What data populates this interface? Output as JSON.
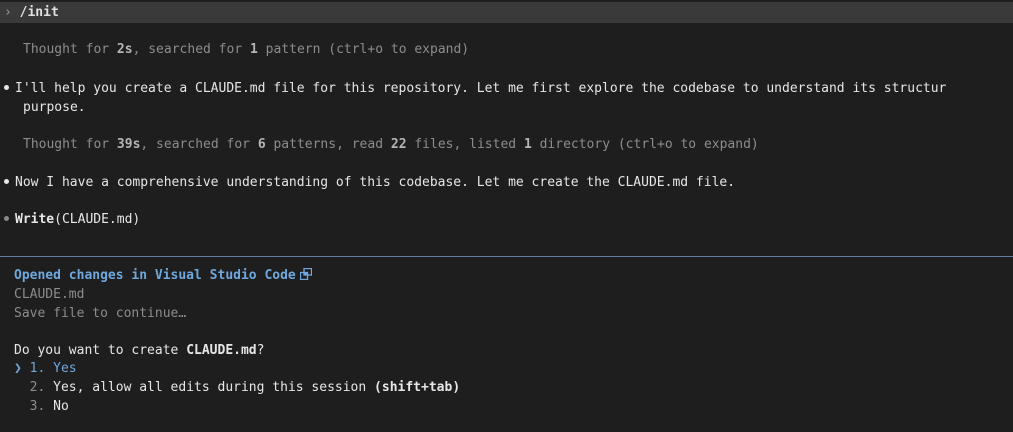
{
  "command": {
    "prompt_glyph": "›",
    "text": "/init"
  },
  "thought1": {
    "prefix": "Thought for ",
    "time": "2s",
    "mid1": ", searched for ",
    "patterns": "1",
    "mid2": " pattern (ctrl+o to expand)"
  },
  "message1": {
    "line1": "I'll help you create a CLAUDE.md file for this repository. Let me first explore the codebase to understand its structur",
    "line2": "purpose."
  },
  "thought2": {
    "prefix": "Thought for ",
    "time": "39s",
    "a": ", searched for ",
    "patterns": "6",
    "b": " patterns, read ",
    "files": "22",
    "c": " files, listed ",
    "dirs": "1",
    "d": " directory (ctrl+o to expand)"
  },
  "message2": "Now I have a comprehensive understanding of this codebase. Let me create the CLAUDE.md file.",
  "tool_call": {
    "name": "Write",
    "arg": "(CLAUDE.md)"
  },
  "panel": {
    "title": "Opened changes in Visual Studio Code",
    "icon": "external-window-icon",
    "filename": "CLAUDE.md",
    "hint": "Save file to continue…",
    "question_prefix": "Do you want to create ",
    "question_file": "CLAUDE.md",
    "question_suffix": "?",
    "selector_glyph": "❯",
    "options": [
      {
        "number": "1.",
        "label": "Yes",
        "shortcut": ""
      },
      {
        "number": "2.",
        "label": "Yes, allow all edits during this session ",
        "shortcut": "(shift+tab)"
      },
      {
        "number": "3.",
        "label": "No",
        "shortcut": ""
      }
    ]
  },
  "colors": {
    "background": "#1e1e1e",
    "accent": "#6fa8dc",
    "divider": "#5b7ea3"
  }
}
